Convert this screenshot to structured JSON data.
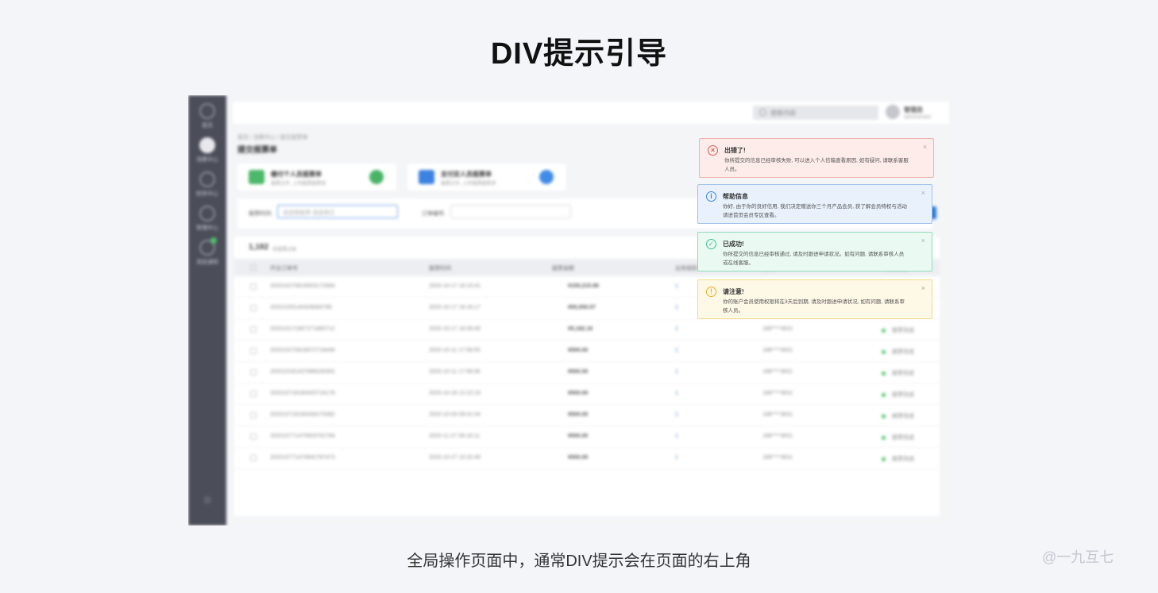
{
  "page": {
    "title": "DIV提示引导",
    "caption": "全局操作页面中，通常DIV提示会在页面的右上角",
    "watermark": "@一九互七"
  },
  "sidebar": {
    "items": [
      {
        "label": "首页",
        "icon": "home-icon"
      },
      {
        "label": "消费中心",
        "icon": "consume-icon",
        "active": true
      },
      {
        "label": "财务中心",
        "icon": "finance-icon"
      },
      {
        "label": "管理中心",
        "icon": "manage-icon"
      },
      {
        "label": "消息通知",
        "icon": "message-icon",
        "badge": true
      }
    ],
    "bottom_icon": "collapse-icon",
    "bottom_glyph": "⊡"
  },
  "topbar": {
    "search_placeholder": "搜索内容",
    "user_name": "管理员",
    "user_sub": "administrator"
  },
  "breadcrumb": "首页 / 消费中心 / 提交报票单",
  "content_title": "提交报票单",
  "cards": [
    {
      "title": "缴付个人员报票单",
      "sub": "报票文件, 上传报票报票单",
      "color": "#4cb86a",
      "btn_color": "#49b466"
    },
    {
      "title": "支付定人员报票单",
      "sub": "报票文件, 上传报票报票单",
      "color": "#3c82e0",
      "btn_color": "#3f8be8"
    }
  ],
  "filter": {
    "label1": "报票时间:",
    "placeholder1": "请选择报票-请选择日",
    "label2": "订单编号:",
    "placeholder2": ""
  },
  "table": {
    "count": "1,182",
    "count_sub": "条报票记录",
    "headers": [
      "开业订单号",
      "报票时间",
      "报票金额",
      "业务规则",
      "报票人",
      "报票状态"
    ],
    "rows": [
      [
        "202010270818003172684",
        "2020-10-17 16:15:41",
        "¥150,215.98",
        "1",
        "188****3631",
        "报票完成"
      ],
      [
        "20201020140428084785",
        "2020-10-17 16:16:17",
        "¥50,000.07",
        "1",
        "188****3631",
        "报票完成"
      ],
      [
        "202010171907271860712",
        "2020-10-17 16:08:40",
        "¥5,182.16",
        "1",
        "188****3631",
        "报票完成"
      ],
      [
        "202010270818072718446",
        "2020-10-11 17:58:55",
        "¥500.00",
        "1",
        "188****3631",
        "报票完成"
      ],
      [
        "202010181437686026302",
        "2020-10-11 17:58:08",
        "¥500.00",
        "1",
        "188****3631",
        "报票完成"
      ],
      [
        "202010718180420716178",
        "2020-10-18 12:22:23",
        "¥500.00",
        "1",
        "188****3631",
        "报票完成"
      ],
      [
        "202010718180430270082",
        "2020-10-03 09:41:04",
        "¥500.00",
        "1",
        "188****3631",
        "报票完成"
      ],
      [
        "202010771470503752784",
        "2020-11-27 09:18:11",
        "¥500.00",
        "1",
        "188****3631",
        "报票完成"
      ],
      [
        "202010771470842787473",
        "2020-10-27 10:32:46",
        "¥500.00",
        "1",
        "188****3631",
        "报票完成"
      ]
    ]
  },
  "notices": [
    {
      "type": "error",
      "title": "出错了!",
      "text": "你所提交的信息已经审核失败, 可以进入个人信箱查看原因, 如有疑问, 请联系客服人员。",
      "bg": "#fdecea",
      "border": "#f2b3ac",
      "icon_color": "#e05a4f",
      "glyph": "×",
      "icon": "error-icon"
    },
    {
      "type": "info",
      "title": "帮助信息",
      "text": "你好, 由于你的良好信用, 我们决定赠送你三个月产品会员, 获了解会员特权与活动请进首页会员专区查看。",
      "bg": "#e8f1fc",
      "border": "#9ec1ee",
      "icon_color": "#3d82dc",
      "glyph": "i",
      "icon": "info-icon"
    },
    {
      "type": "success",
      "title": "已成功!",
      "text": "你所提交的信息已经审核通过, 请及时跟进申请状况。如有问题, 请联系审核人员或在线客服。",
      "bg": "#eafaf3",
      "border": "#8fdcbb",
      "icon_color": "#3cc08a",
      "glyph": "✓",
      "icon": "success-icon"
    },
    {
      "type": "warning",
      "title": "请注意!",
      "text": "你的账户会员使用权限将在3天后到期, 请及时跟进申请状况, 如有问题, 请联系审核人员。",
      "bg": "#fef8e7",
      "border": "#f5d98a",
      "icon_color": "#e8b215",
      "glyph": "!",
      "icon": "warning-icon"
    }
  ],
  "close_glyph": "×"
}
